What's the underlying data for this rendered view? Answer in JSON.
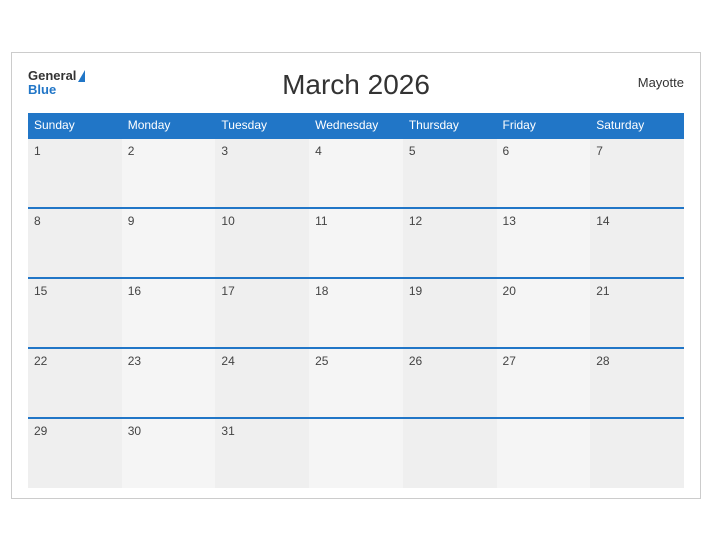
{
  "header": {
    "title": "March 2026",
    "region": "Mayotte",
    "logo_general": "General",
    "logo_blue": "Blue"
  },
  "weekdays": [
    "Sunday",
    "Monday",
    "Tuesday",
    "Wednesday",
    "Thursday",
    "Friday",
    "Saturday"
  ],
  "weeks": [
    [
      1,
      2,
      3,
      4,
      5,
      6,
      7
    ],
    [
      8,
      9,
      10,
      11,
      12,
      13,
      14
    ],
    [
      15,
      16,
      17,
      18,
      19,
      20,
      21
    ],
    [
      22,
      23,
      24,
      25,
      26,
      27,
      28
    ],
    [
      29,
      30,
      31,
      null,
      null,
      null,
      null
    ]
  ]
}
